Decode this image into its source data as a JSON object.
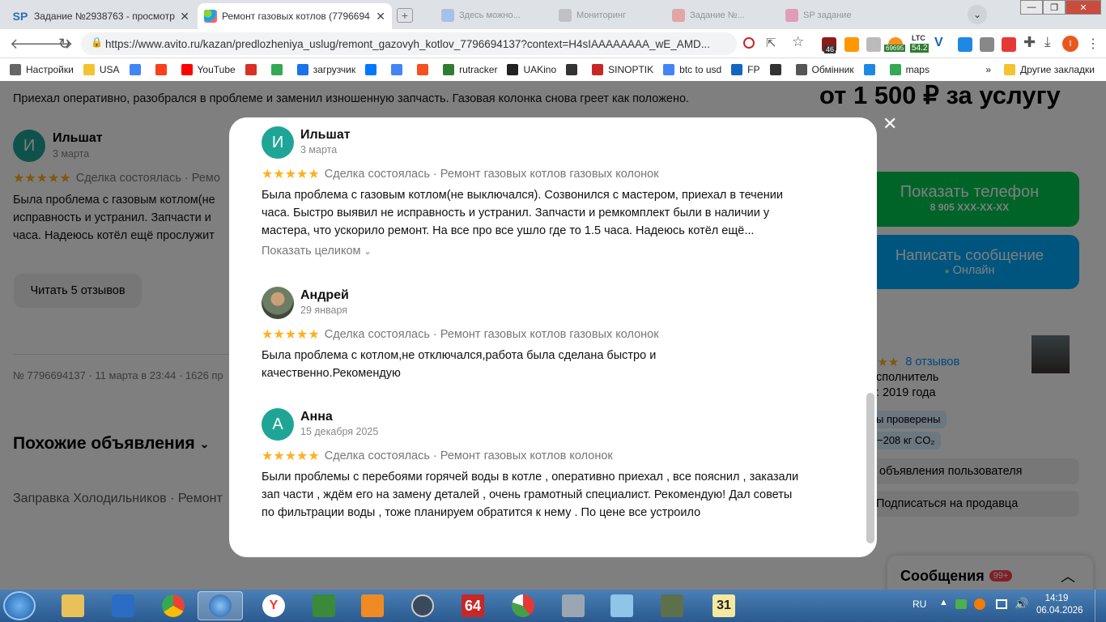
{
  "browser": {
    "tabs": [
      {
        "label": "Задание №2938763 - просмотр з",
        "favicon": "SP"
      },
      {
        "label": "Ремонт газовых котлов (7796694",
        "favicon": ""
      }
    ],
    "url": "https://www.avito.ru/kazan/predlozheniya_uslug/remont_gazovyh_kotlov_7796694137?context=H4sIAAAAAAAA_wE_AMD...",
    "ext_badges": {
      "b1": "46",
      "ltc": "LTC",
      "ltc_val": "54.2",
      "num": "69695"
    },
    "bookmarks": [
      {
        "label": "Настройки",
        "icon": "gear-icon",
        "color": "#666"
      },
      {
        "label": "USA",
        "icon": "folder-icon",
        "color": "#f4c430"
      },
      {
        "label": "",
        "icon": "google-icon",
        "color": "#4285f4"
      },
      {
        "label": "",
        "icon": "yandex-icon",
        "color": "#fc3f1d"
      },
      {
        "label": "YouTube",
        "icon": "youtube-icon",
        "color": "#ff0000"
      },
      {
        "label": "",
        "icon": "gmail-icon",
        "color": "#d93025"
      },
      {
        "label": "",
        "icon": "drive-icon",
        "color": "#34a853"
      },
      {
        "label": "загрузчик",
        "icon": "loader-icon",
        "color": "#1a73e8"
      },
      {
        "label": "",
        "icon": "vk-icon",
        "color": "#0077ff"
      },
      {
        "label": "",
        "icon": "translate-icon",
        "color": "#4285f4"
      },
      {
        "label": "",
        "icon": "f-icon",
        "color": "#f4511e"
      },
      {
        "label": "rutracker",
        "icon": "rutracker-icon",
        "color": "#2e7d32"
      },
      {
        "label": "UAKino",
        "icon": "uakino-icon",
        "color": "#222"
      },
      {
        "label": "",
        "icon": "chess-icon",
        "color": "#333"
      },
      {
        "label": "SINOPTIK",
        "icon": "thermometer-icon",
        "color": "#c62828"
      },
      {
        "label": "btc to usd",
        "icon": "google-icon",
        "color": "#4285f4"
      },
      {
        "label": "FP",
        "icon": "fp-icon",
        "color": "#1565c0"
      },
      {
        "label": "",
        "icon": "bc-icon",
        "color": "#333"
      },
      {
        "label": "Обмінник",
        "icon": "exchange-icon",
        "color": "#555"
      },
      {
        "label": "",
        "icon": "star-burst-icon",
        "color": "#1e88e5"
      },
      {
        "label": "maps",
        "icon": "maps-icon",
        "color": "#34a853"
      }
    ],
    "bookmarks_more": "»",
    "other_bookmarks": "Другие закладки"
  },
  "background": {
    "price": "от 1 500 ₽ за услугу",
    "prev_review_text": "Приехал оперативно, разобрался в проблеме и заменил изношенную запчасть. Газовая колонка снова греет как положено.",
    "review_name": "Ильшат",
    "review_date": "3 марта",
    "review_meta": "Сделка состоялась · Ремо",
    "review_lines": [
      "Была проблема с газовым котлом(не",
      "исправность и устранил. Запчасти и",
      "часа. Надеюсь котёл ещё прослужит"
    ],
    "read_reviews": "Читать 5 отзывов",
    "listing_meta": "№ 7796694137 · 11 марта в 23:44 · 1626 пр",
    "similar": "Похожие объявления",
    "similar_items": "Заправка Холодильников · Ремонт",
    "show_phone": "Показать телефон",
    "phone": "8 905 XXX-XX-XX",
    "write_message": "Написать сообщение",
    "online": "Онлайн",
    "seller_reviews": "8 отзывов",
    "seller_role": "сполнитель",
    "seller_since": ": 2019 года",
    "badge_checked": "ы проверены",
    "badge_co2": "−208 кг CO₂",
    "user_ads": "объявления пользователя",
    "subscribe": "Подписаться на продавца",
    "messages": "Сообщения",
    "messages_count": "99+"
  },
  "modal": {
    "reviews": [
      {
        "initial": "И",
        "avatar_color": "#1fa596",
        "name": "Ильшат",
        "date": "3 марта",
        "stars": "★★★★★",
        "meta": "Сделка состоялась · Ремонт газовых котлов газовых колонок",
        "lines": [
          "Была проблема с газовым котлом(не выключался). Созвонился с мастером, приехал в течении",
          "часа. Быстро выявил не исправность и устранил. Запчасти и ремкомплект были в наличии у",
          "мастера, что ускорило ремонт. На все про все ушло где то 1.5 часа. Надеюсь котёл ещё..."
        ],
        "expand": "Показать целиком"
      },
      {
        "initial": "",
        "avatar_color": "#7a8a70",
        "name": "Андрей",
        "date": "29 января",
        "stars": "★★★★★",
        "meta": "Сделка состоялась · Ремонт газовых котлов газовых колонок",
        "lines": [
          "Была проблема с котлом,не отключался,работа была сделана быстро и",
          "качественно.Рекомендую"
        ]
      },
      {
        "initial": "А",
        "avatar_color": "#1fa596",
        "name": "Анна",
        "date": "15 декабря 2025",
        "stars": "★★★★★",
        "meta": "Сделка состоялась · Ремонт газовых котлов колонок",
        "lines": [
          "Были проблемы с перебоями горячей воды в котле , оперативно приехал , все пояснил , заказали",
          "зап части , ждём его на замену деталей , очень грамотный специалист. Рекомендую! Дал советы",
          "по фильтрации воды , тоже планируем обратится к нему . По цене все устроило"
        ]
      }
    ],
    "close": "✕"
  },
  "taskbar": {
    "lang": "RU",
    "time": "14:19",
    "date": "06.04.2026",
    "calendar_day": "31"
  }
}
